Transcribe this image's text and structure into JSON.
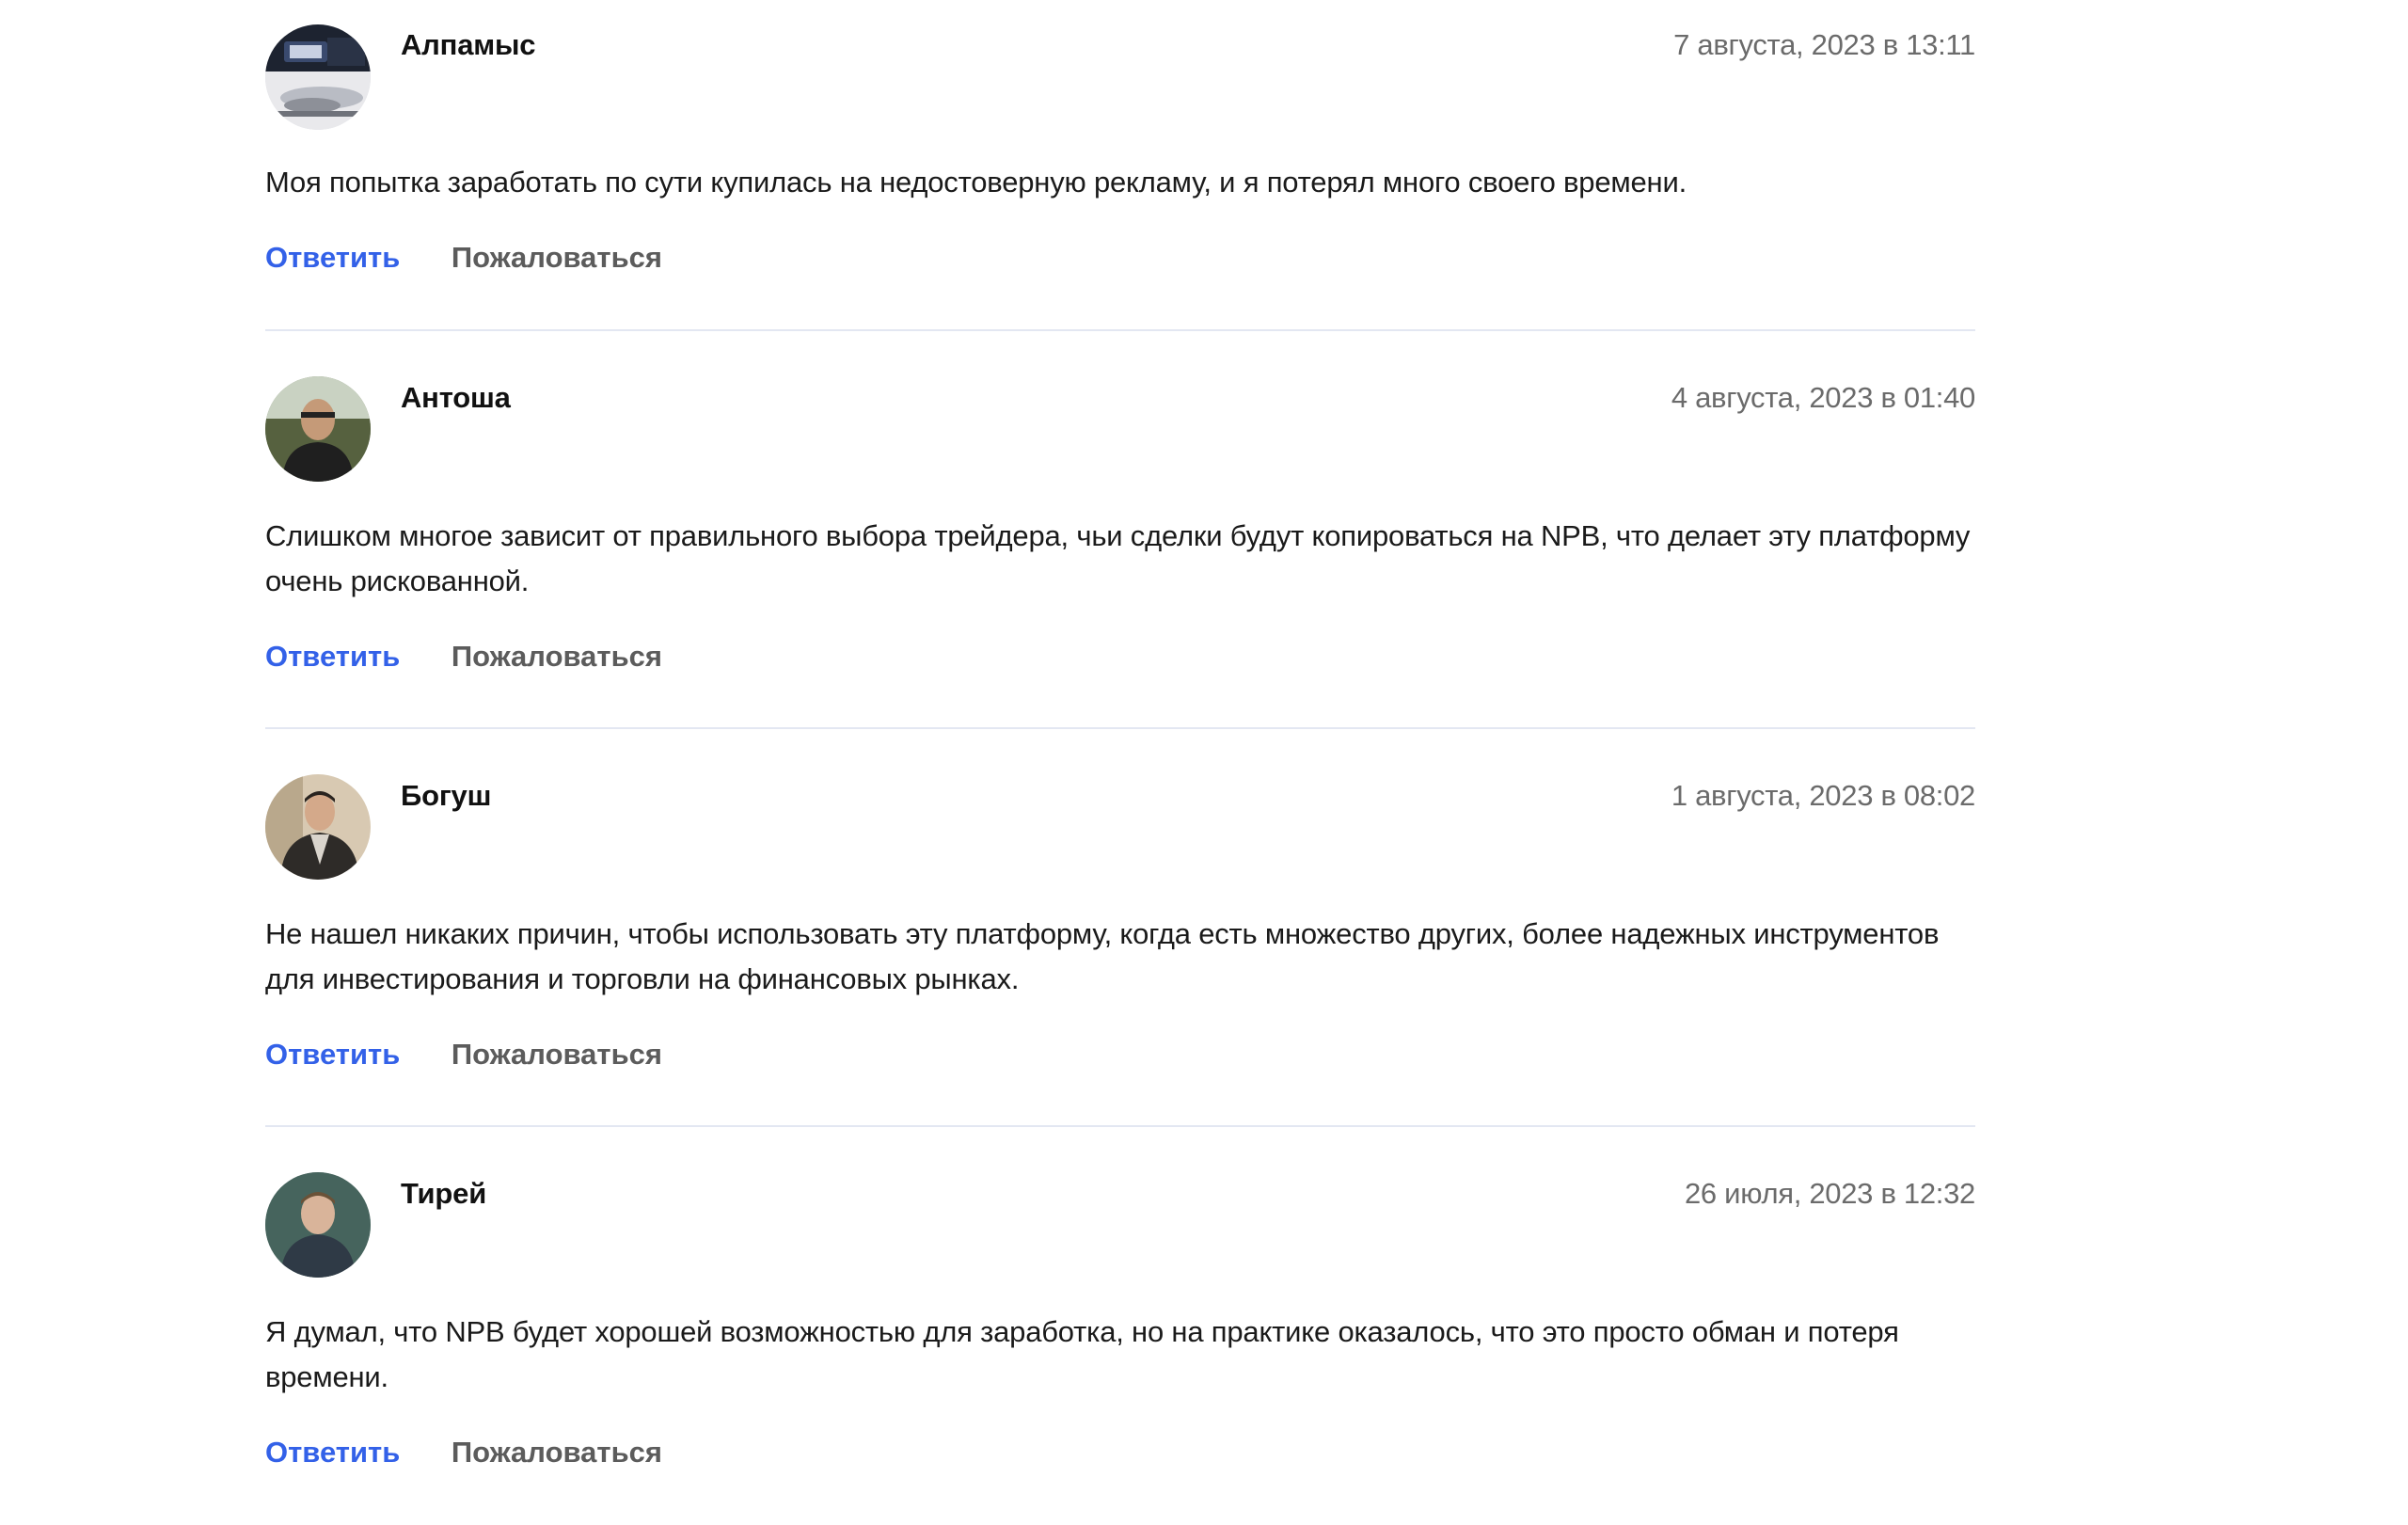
{
  "comments": [
    {
      "author": "Алпамыс",
      "date": "7 августа, 2023 в 13:11",
      "text": "Моя попытка заработать по сути купилась на недостоверную рекламу, и я потерял много своего времени.",
      "avatar_icon": "car-photo-avatar",
      "reply_label": "Ответить",
      "report_label": "Пожаловаться"
    },
    {
      "author": "Антоша",
      "date": "4 августа, 2023 в 01:40",
      "text": "Слишком многое зависит от правильного выбора трейдера, чьи сделки будут копироваться на NPB, что делает эту платформу очень рискованной.",
      "avatar_icon": "person-photo-avatar",
      "reply_label": "Ответить",
      "report_label": "Пожаловаться"
    },
    {
      "author": "Богуш",
      "date": "1 августа, 2023 в 08:02",
      "text": "Не нашел никаких причин, чтобы использовать эту платформу, когда есть множество других, более надежных инструментов для инвестирования и торговли на финансовых рынках.",
      "avatar_icon": "person-photo-avatar",
      "reply_label": "Ответить",
      "report_label": "Пожаловаться"
    },
    {
      "author": "Тирей",
      "date": "26 июля, 2023 в 12:32",
      "text": "Я думал, что NPB будет хорошей возможностью для заработка, но на практике оказалось, что это просто обман и потеря времени.",
      "avatar_icon": "person-photo-avatar",
      "reply_label": "Ответить",
      "report_label": "Пожаловаться"
    }
  ],
  "colors": {
    "reply_link": "#3361e8",
    "report_link": "#5c5c5c",
    "date_text": "#6b6b6b",
    "divider": "#e3e7f2"
  }
}
